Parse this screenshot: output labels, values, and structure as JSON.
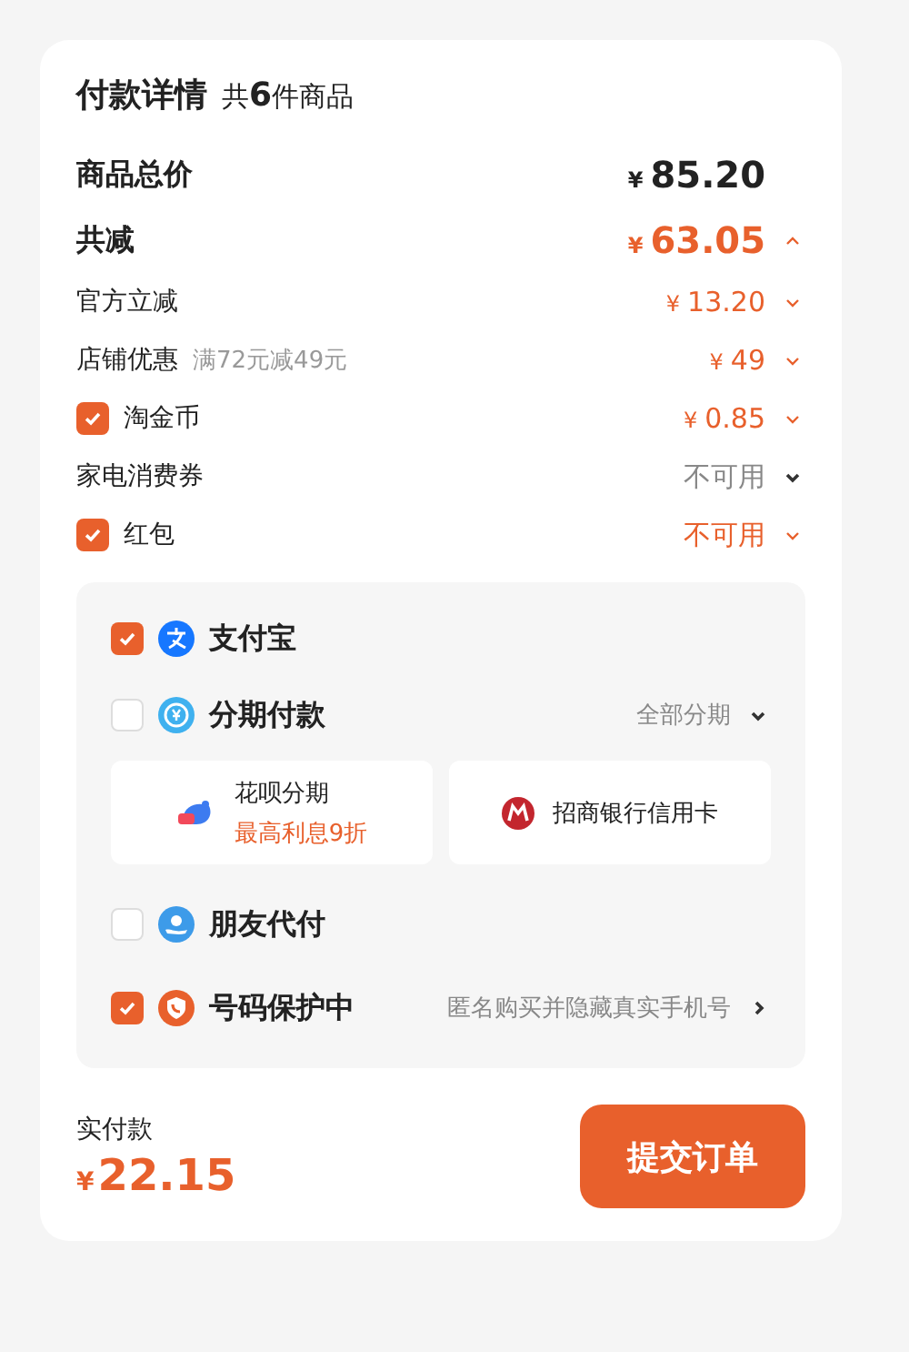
{
  "header": {
    "title": "付款详情",
    "count_prefix": "共",
    "count": "6",
    "count_suffix": "件商品"
  },
  "summary": [
    {
      "kind": "total",
      "label": "商品总价",
      "yen": "¥",
      "amount": "85.20"
    },
    {
      "kind": "total",
      "label": "共减",
      "yen": "¥",
      "amount": "63.05",
      "expanded": true
    },
    {
      "kind": "discount",
      "label": "官方立减",
      "yen": "¥",
      "amount": "13.20",
      "expanded": false
    },
    {
      "kind": "discount",
      "label": "店铺优惠",
      "note": "满72元减49元",
      "yen": "¥",
      "amount": "49",
      "expanded": false
    },
    {
      "kind": "toggle",
      "checked": true,
      "label": "淘金币",
      "yen": "¥",
      "amount": "0.85",
      "expanded": false
    },
    {
      "kind": "discount",
      "label": "家电消费券",
      "amount": "不可用",
      "disabled": true,
      "expanded": false
    },
    {
      "kind": "toggle",
      "checked": true,
      "label": "红包",
      "amount": "不可用",
      "expanded": false
    }
  ],
  "payment_methods": [
    {
      "kind": "wallet",
      "checked": true,
      "label": "支付宝"
    },
    {
      "kind": "installment",
      "checked": false,
      "label": "分期付款",
      "option": "全部分期",
      "expanded": false,
      "plans": [
        {
          "kind": "credit",
          "title": "花呗分期",
          "subtitle": "最高利息9折"
        },
        {
          "kind": "bank",
          "title": "招商银行信用卡"
        }
      ]
    },
    {
      "kind": "friend",
      "checked": false,
      "label": "朋友代付"
    },
    {
      "kind": "privacy",
      "checked": true,
      "label": "号码保护中",
      "option": "匿名购买并隐藏真实手机号"
    }
  ],
  "footer": {
    "label": "实付款",
    "yen": "¥",
    "amount": "22.15",
    "button": "提交订单"
  }
}
